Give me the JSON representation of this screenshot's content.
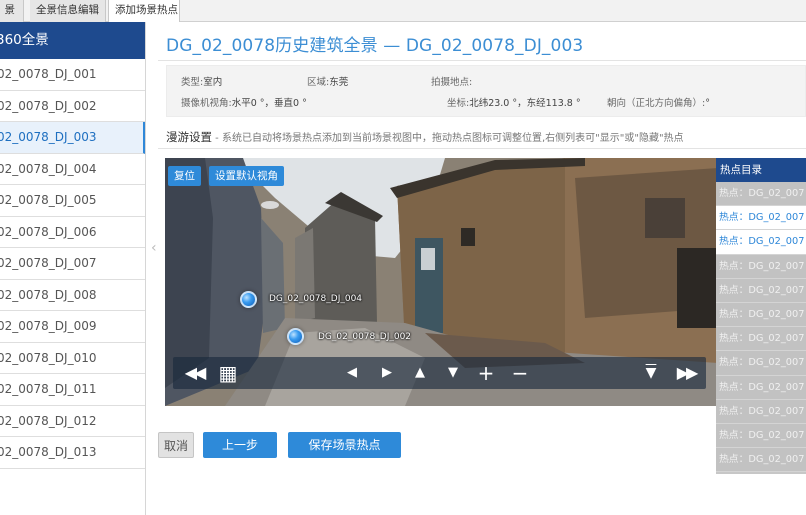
{
  "tabs": [
    "景",
    "全景信息编辑",
    "添加场景热点"
  ],
  "sidebar": {
    "title": "360全景",
    "items": [
      "02_0078_DJ_001",
      "02_0078_DJ_002",
      "02_0078_DJ_003",
      "02_0078_DJ_004",
      "02_0078_DJ_005",
      "02_0078_DJ_006",
      "02_0078_DJ_007",
      "02_0078_DJ_008",
      "02_0078_DJ_009",
      "02_0078_DJ_010",
      "02_0078_DJ_011",
      "02_0078_DJ_012",
      "02_0078_DJ_013"
    ],
    "active_index": 2
  },
  "collapse_glyph": "‹",
  "page_title": "DG_02_0078历史建筑全景 — DG_02_0078_DJ_003",
  "info": {
    "type_label": "类型:",
    "type_value": "室内",
    "region_label": "区域:",
    "region_value": "东莞",
    "place_label": "拍摄地点:",
    "place_value": "",
    "camera_label": "摄像机视角:",
    "camera_value": "水平0 °，垂直0 °",
    "coord_label": "坐标:",
    "coord_value": "北纬23.0 °，东经113.8 °",
    "heading_label": "朝向（正北方向偏角）:",
    "heading_value": "°"
  },
  "tour": {
    "title": "漫游设置",
    "desc": " - 系统已自动将场景热点添加到当前场景视图中，拖动热点图标可调整位置,右侧列表可\"显示\"或\"隐藏\"热点"
  },
  "viewer": {
    "reset_label": "复位",
    "set_view_label": "设置默认视角",
    "hotspots": [
      "DG_02_0078_DJ_004",
      "DG_02_0078_DJ_002"
    ],
    "controls": {
      "rewind": "◀◀",
      "grid": "▦",
      "left": "◀",
      "right": "▶",
      "up": "▲",
      "down": "▼",
      "zoom_in": "+",
      "zoom_out": "−",
      "hide": "▼",
      "forward": "▶▶"
    }
  },
  "hotspot_panel": {
    "title": "热点目录",
    "items": [
      {
        "label": "热点：DG_02_007",
        "shown": false
      },
      {
        "label": "热点：DG_02_007",
        "shown": true
      },
      {
        "label": "热点：DG_02_007",
        "shown": true
      },
      {
        "label": "热点：DG_02_007",
        "shown": false
      },
      {
        "label": "热点：DG_02_007",
        "shown": false
      },
      {
        "label": "热点：DG_02_007",
        "shown": false
      },
      {
        "label": "热点：DG_02_007",
        "shown": false
      },
      {
        "label": "热点：DG_02_007",
        "shown": false
      },
      {
        "label": "热点：DG_02_007",
        "shown": false
      },
      {
        "label": "热点：DG_02_007",
        "shown": false
      },
      {
        "label": "热点：DG_02_007",
        "shown": false
      },
      {
        "label": "热点：DG_02_007",
        "shown": false
      }
    ]
  },
  "buttons": {
    "cancel": "取消",
    "prev": "上一步",
    "save": "保存场景热点"
  },
  "colors": {
    "accent": "#2e8ad9",
    "header_blue": "#1e4a8e",
    "title_blue": "#3c8ed4"
  }
}
